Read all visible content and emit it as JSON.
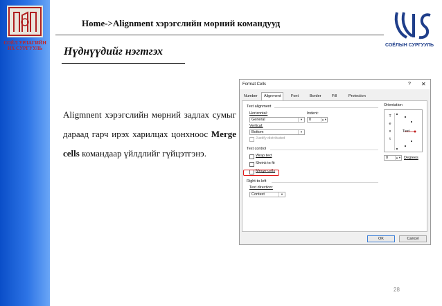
{
  "header": {
    "title": "Home->Alignment хэрэгслийн мөрний командууд",
    "left_logo_caption": "СОЁЛ УРЛАГИЙН ИХ СУРГУУЛЬ",
    "right_logo_caption": "СОЁЛЫН СУРГУУЛЬ"
  },
  "subtitle": "Нүднүүдийг нэгтгэх",
  "body": {
    "line_part1": "Aligmnent хэрэгслийн мөрний задлах сумыг дараад гарч ирэх харилцах цонхноос ",
    "bold": "Merge cells",
    "line_part2": " командаар үйлдлийг гүйцэтгэнэ."
  },
  "page_number": "28",
  "dialog": {
    "title": "Format Cells",
    "help": "?",
    "close": "✕",
    "tabs": [
      "Number",
      "Alignment",
      "Font",
      "Border",
      "Fill",
      "Protection"
    ],
    "active_tab": "Alignment",
    "text_alignment": {
      "group": "Text alignment",
      "horizontal_label": "Horizontal:",
      "horizontal_value": "General",
      "indent_label": "Indent:",
      "indent_value": "0",
      "vertical_label": "Vertical:",
      "vertical_value": "Bottom",
      "justify_distributed": "Justify distributed"
    },
    "text_control": {
      "group": "Text control",
      "wrap_text": "Wrap text",
      "shrink_to_fit": "Shrink to fit",
      "merge_cells": "Merge cells"
    },
    "right_to_left": {
      "group": "Right-to-left",
      "direction_label": "Text direction:",
      "direction_value": "Context"
    },
    "orientation": {
      "group": "Orientation",
      "vertical_text": [
        "T",
        "e",
        "x",
        "t"
      ],
      "rotated_text": "Text",
      "degrees_value": "0",
      "degrees_label": "Degrees"
    },
    "buttons": {
      "ok": "OK",
      "cancel": "Cancel"
    }
  }
}
